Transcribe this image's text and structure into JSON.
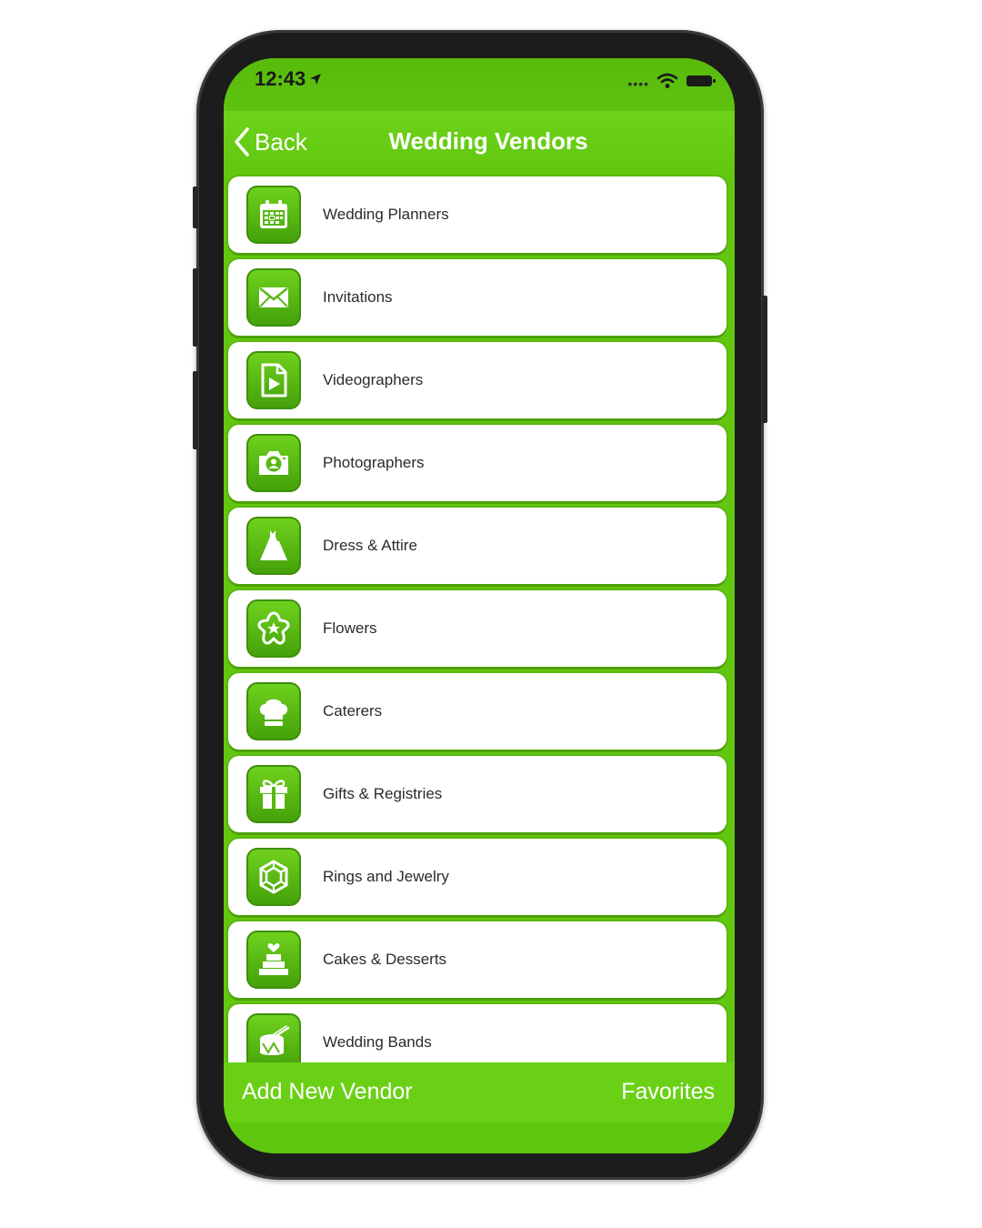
{
  "status_bar": {
    "time": "12:43"
  },
  "nav": {
    "back_label": "Back",
    "title": "Wedding Vendors"
  },
  "vendors": [
    {
      "label": "Wedding Planners",
      "icon": "calendar-icon"
    },
    {
      "label": "Invitations",
      "icon": "envelope-icon"
    },
    {
      "label": "Videographers",
      "icon": "video-file-icon"
    },
    {
      "label": "Photographers",
      "icon": "camera-icon"
    },
    {
      "label": "Dress & Attire",
      "icon": "dress-icon"
    },
    {
      "label": "Flowers",
      "icon": "flower-icon"
    },
    {
      "label": "Caterers",
      "icon": "chef-hat-icon"
    },
    {
      "label": "Gifts & Registries",
      "icon": "gift-icon"
    },
    {
      "label": "Rings and Jewelry",
      "icon": "gem-icon"
    },
    {
      "label": "Cakes & Desserts",
      "icon": "cake-icon"
    },
    {
      "label": "Wedding Bands",
      "icon": "drum-icon"
    }
  ],
  "toolbar": {
    "add_label": "Add New Vendor",
    "favorites_label": "Favorites"
  },
  "colors": {
    "accent": "#63c70f",
    "icon_bg": "#55b512",
    "row_bg": "#ffffff"
  }
}
